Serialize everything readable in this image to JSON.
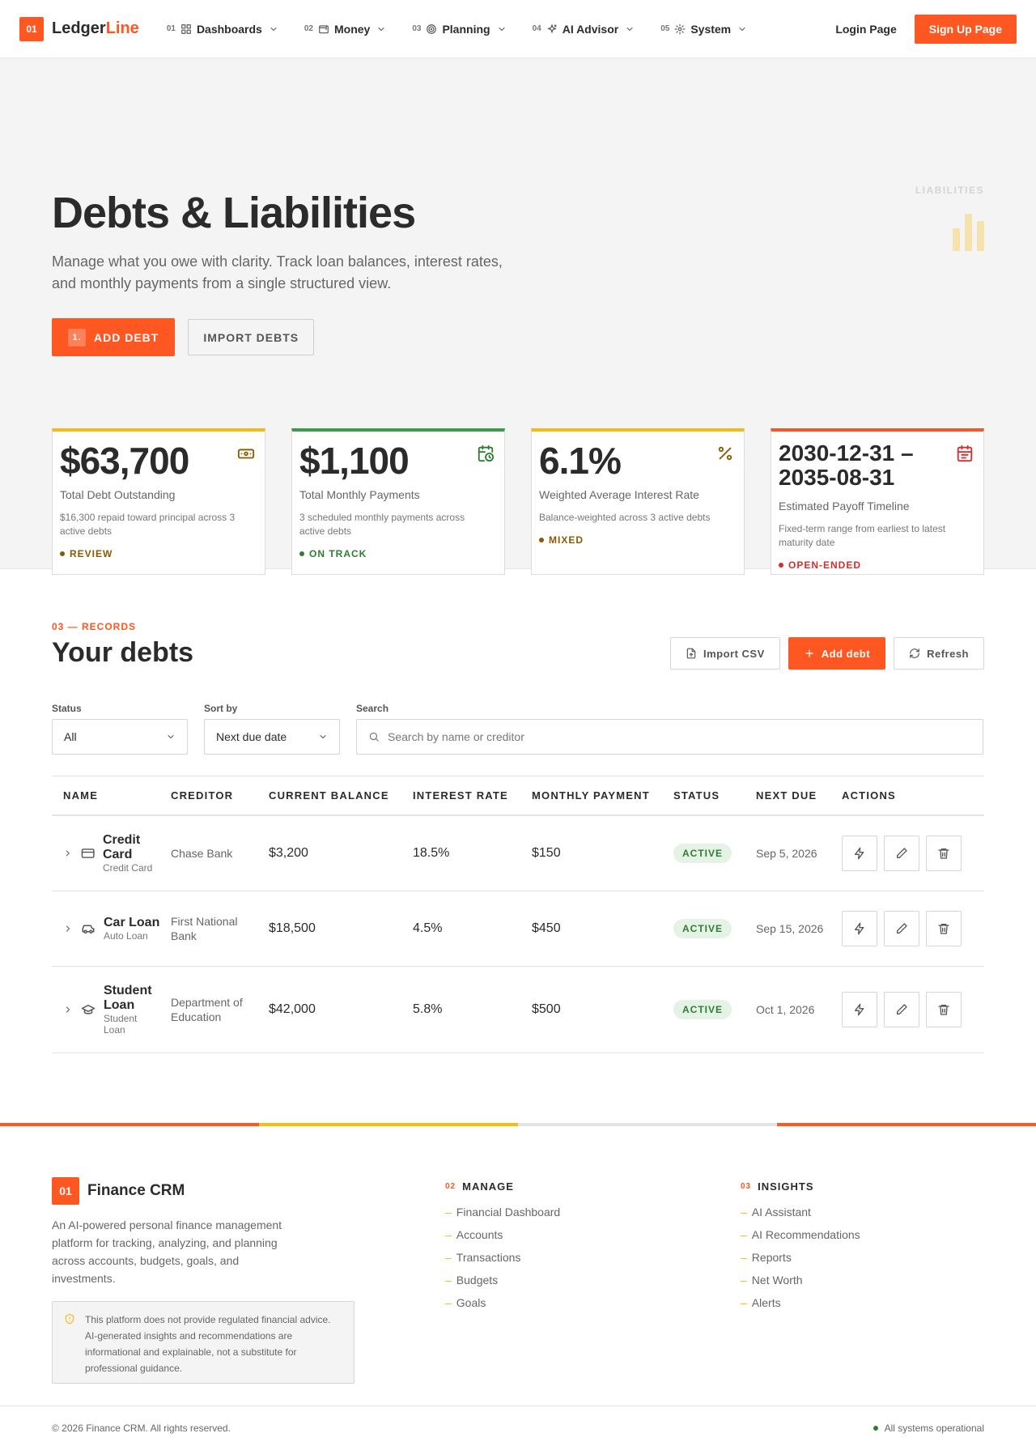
{
  "nav": {
    "logo_badge": "01",
    "logo_main": "Ledger",
    "logo_accent": "Line",
    "items": [
      {
        "num": "01",
        "label": "Dashboards",
        "icon": "grid-icon"
      },
      {
        "num": "02",
        "label": "Money",
        "icon": "wallet-icon"
      },
      {
        "num": "03",
        "label": "Planning",
        "icon": "target-icon"
      },
      {
        "num": "04",
        "label": "AI Advisor",
        "icon": "sparkle-icon"
      },
      {
        "num": "05",
        "label": "System",
        "icon": "gear-icon"
      }
    ],
    "login": "Login Page",
    "signup": "Sign Up Page"
  },
  "hero": {
    "title": "Debts & Liabilities",
    "description": "Manage what you owe with clarity. Track loan balances, interest rates, and monthly payments from a single structured view.",
    "add_num": "1.",
    "add_label": "ADD DEBT",
    "import_label": "IMPORT DEBTS",
    "side_label": "LIABILITIES"
  },
  "cards": [
    {
      "value": "$63,700",
      "title": "Total Debt Outstanding",
      "sub": "$16,300 repaid toward principal across 3 active debts",
      "badge": "REVIEW",
      "badge_color": "#8a5a00",
      "icon": "cash-icon"
    },
    {
      "value": "$1,100",
      "title": "Total Monthly Payments",
      "sub": "3 scheduled monthly payments across active debts",
      "badge": "ON TRACK",
      "badge_color": "#2e7d32",
      "icon": "calendar-clock-icon"
    },
    {
      "value": "6.1%",
      "title": "Weighted Average Interest Rate",
      "sub": "Balance-weighted across 3 active debts",
      "badge": "MIXED",
      "badge_color": "#8a5a00",
      "icon": "percent-icon"
    },
    {
      "value": "2030-12-31 – 2035-08-31",
      "title": "Estimated Payoff Timeline",
      "sub": "Fixed-term range from earliest to latest maturity date",
      "badge": "OPEN-ENDED",
      "badge_color": "#d32f2f",
      "icon": "calendar-icon"
    }
  ],
  "records": {
    "label": "03 — RECORDS",
    "title": "Your debts",
    "import_csv": "Import CSV",
    "add_debt": "Add debt",
    "refresh": "Refresh",
    "filters": {
      "status_label": "Status",
      "status_value": "All",
      "sort_label": "Sort by",
      "sort_value": "Next due date",
      "search_label": "Search",
      "search_placeholder": "Search by name or creditor"
    },
    "columns": [
      "NAME",
      "CREDITOR",
      "CURRENT BALANCE",
      "INTEREST RATE",
      "MONTHLY PAYMENT",
      "STATUS",
      "NEXT DUE",
      "ACTIONS"
    ],
    "rows": [
      {
        "name": "Credit Card",
        "type": "Credit Card",
        "creditor": "Chase Bank",
        "balance": "$3,200",
        "rate": "18.5%",
        "payment": "$150",
        "status": "ACTIVE",
        "due": "Sep 5, 2026",
        "icon": "credit-card-icon"
      },
      {
        "name": "Car Loan",
        "type": "Auto Loan",
        "creditor": "First National Bank",
        "balance": "$18,500",
        "rate": "4.5%",
        "payment": "$450",
        "status": "ACTIVE",
        "due": "Sep 15, 2026",
        "icon": "car-icon"
      },
      {
        "name": "Student Loan",
        "type": "Student Loan",
        "creditor": "Department of Education",
        "balance": "$42,000",
        "rate": "5.8%",
        "payment": "$500",
        "status": "ACTIVE",
        "due": "Oct 1, 2026",
        "icon": "graduation-cap-icon"
      }
    ]
  },
  "footer": {
    "badge": "01",
    "name": "Finance CRM",
    "description": "An AI-powered personal finance management platform for tracking, analyzing, and planning across accounts, budgets, goals, and investments.",
    "disclaimer": "This platform does not provide regulated financial advice. AI-generated insights and recommendations are informational and explainable, not a substitute for professional guidance.",
    "manage_num": "02",
    "manage_title": "MANAGE",
    "manage_links": [
      "Financial Dashboard",
      "Accounts",
      "Transactions",
      "Budgets",
      "Goals"
    ],
    "insights_num": "03",
    "insights_title": "INSIGHTS",
    "insights_links": [
      "AI Assistant",
      "AI Recommendations",
      "Reports",
      "Net Worth",
      "Alerts"
    ],
    "copyright": "© 2026 Finance CRM. All rights reserved.",
    "system_status": "All systems operational"
  },
  "colors": {
    "accent": "#ff5722",
    "yellow": "#f5bb15",
    "green": "#3c9a4d",
    "red": "#f05a28"
  }
}
